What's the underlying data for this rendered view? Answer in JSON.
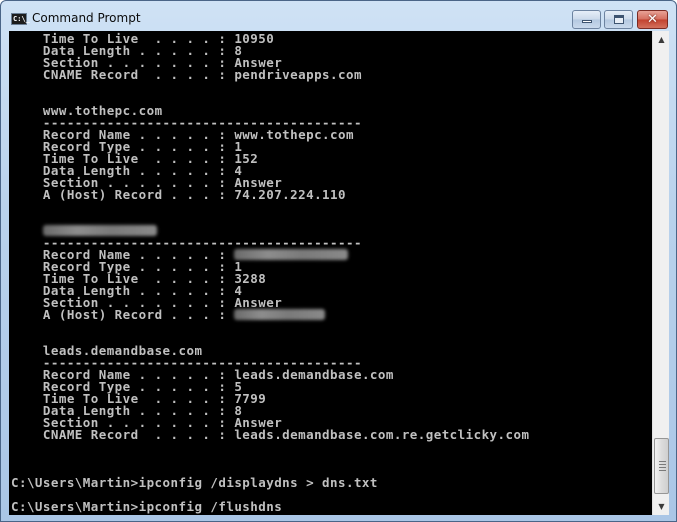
{
  "window": {
    "title": "Command Prompt",
    "icon": "cmd-icon",
    "controls": {
      "minimize": "minimize-icon",
      "maximize": "maximize-icon",
      "close": "close-icon",
      "close_glyph": "✕"
    }
  },
  "console": {
    "lines": [
      {
        "kind": "field",
        "label": "Time To Live  . . . . ",
        "value": "10950"
      },
      {
        "kind": "field",
        "label": "Data Length . . . . . ",
        "value": "8"
      },
      {
        "kind": "field",
        "label": "Section . . . . . . . ",
        "value": "Answer"
      },
      {
        "kind": "field",
        "label": "CNAME Record  . . . . ",
        "value": "pendriveapps.com"
      },
      {
        "kind": "blank"
      },
      {
        "kind": "blank"
      },
      {
        "kind": "heading",
        "text": "www.tothepc.com"
      },
      {
        "kind": "rule",
        "text": "----------------------------------------"
      },
      {
        "kind": "field",
        "label": "Record Name . . . . . ",
        "value": "www.tothepc.com"
      },
      {
        "kind": "field",
        "label": "Record Type . . . . . ",
        "value": "1"
      },
      {
        "kind": "field",
        "label": "Time To Live  . . . . ",
        "value": "152"
      },
      {
        "kind": "field",
        "label": "Data Length . . . . . ",
        "value": "4"
      },
      {
        "kind": "field",
        "label": "Section . . . . . . . ",
        "value": "Answer"
      },
      {
        "kind": "field",
        "label": "A (Host) Record . . . ",
        "value": "74.207.224.110"
      },
      {
        "kind": "blank"
      },
      {
        "kind": "blank"
      },
      {
        "kind": "heading",
        "text": "",
        "redacted": true,
        "redacted_chars": 14
      },
      {
        "kind": "rule",
        "text": "----------------------------------------"
      },
      {
        "kind": "field",
        "label": "Record Name . . . . . ",
        "value": "",
        "redacted": true,
        "redacted_chars": 14
      },
      {
        "kind": "field",
        "label": "Record Type . . . . . ",
        "value": "1"
      },
      {
        "kind": "field",
        "label": "Time To Live  . . . . ",
        "value": "3288"
      },
      {
        "kind": "field",
        "label": "Data Length . . . . . ",
        "value": "4"
      },
      {
        "kind": "field",
        "label": "Section . . . . . . . ",
        "value": "Answer"
      },
      {
        "kind": "field",
        "label": "A (Host) Record . . . ",
        "value": "",
        "redacted": true,
        "redacted_chars": 11
      },
      {
        "kind": "blank"
      },
      {
        "kind": "blank"
      },
      {
        "kind": "heading",
        "text": "leads.demandbase.com"
      },
      {
        "kind": "rule",
        "text": "----------------------------------------"
      },
      {
        "kind": "field",
        "label": "Record Name . . . . . ",
        "value": "leads.demandbase.com"
      },
      {
        "kind": "field",
        "label": "Record Type . . . . . ",
        "value": "5"
      },
      {
        "kind": "field",
        "label": "Time To Live  . . . . ",
        "value": "7799"
      },
      {
        "kind": "field",
        "label": "Data Length . . . . . ",
        "value": "8"
      },
      {
        "kind": "field",
        "label": "Section . . . . . . . ",
        "value": "Answer"
      },
      {
        "kind": "field",
        "label": "CNAME Record  . . . . ",
        "value": "leads.demandbase.com.re.getclicky.com"
      },
      {
        "kind": "blank"
      },
      {
        "kind": "blank"
      },
      {
        "kind": "blank"
      },
      {
        "kind": "prompt",
        "text": "C:\\Users\\Martin>ipconfig /displaydns > dns.txt"
      },
      {
        "kind": "blank"
      },
      {
        "kind": "prompt",
        "text": "C:\\Users\\Martin>ipconfig /flushdns"
      }
    ],
    "separator": ": ",
    "indent": "    "
  },
  "scrollbar": {
    "up_arrow": "▲",
    "down_arrow": "▼",
    "position": 0.92
  }
}
